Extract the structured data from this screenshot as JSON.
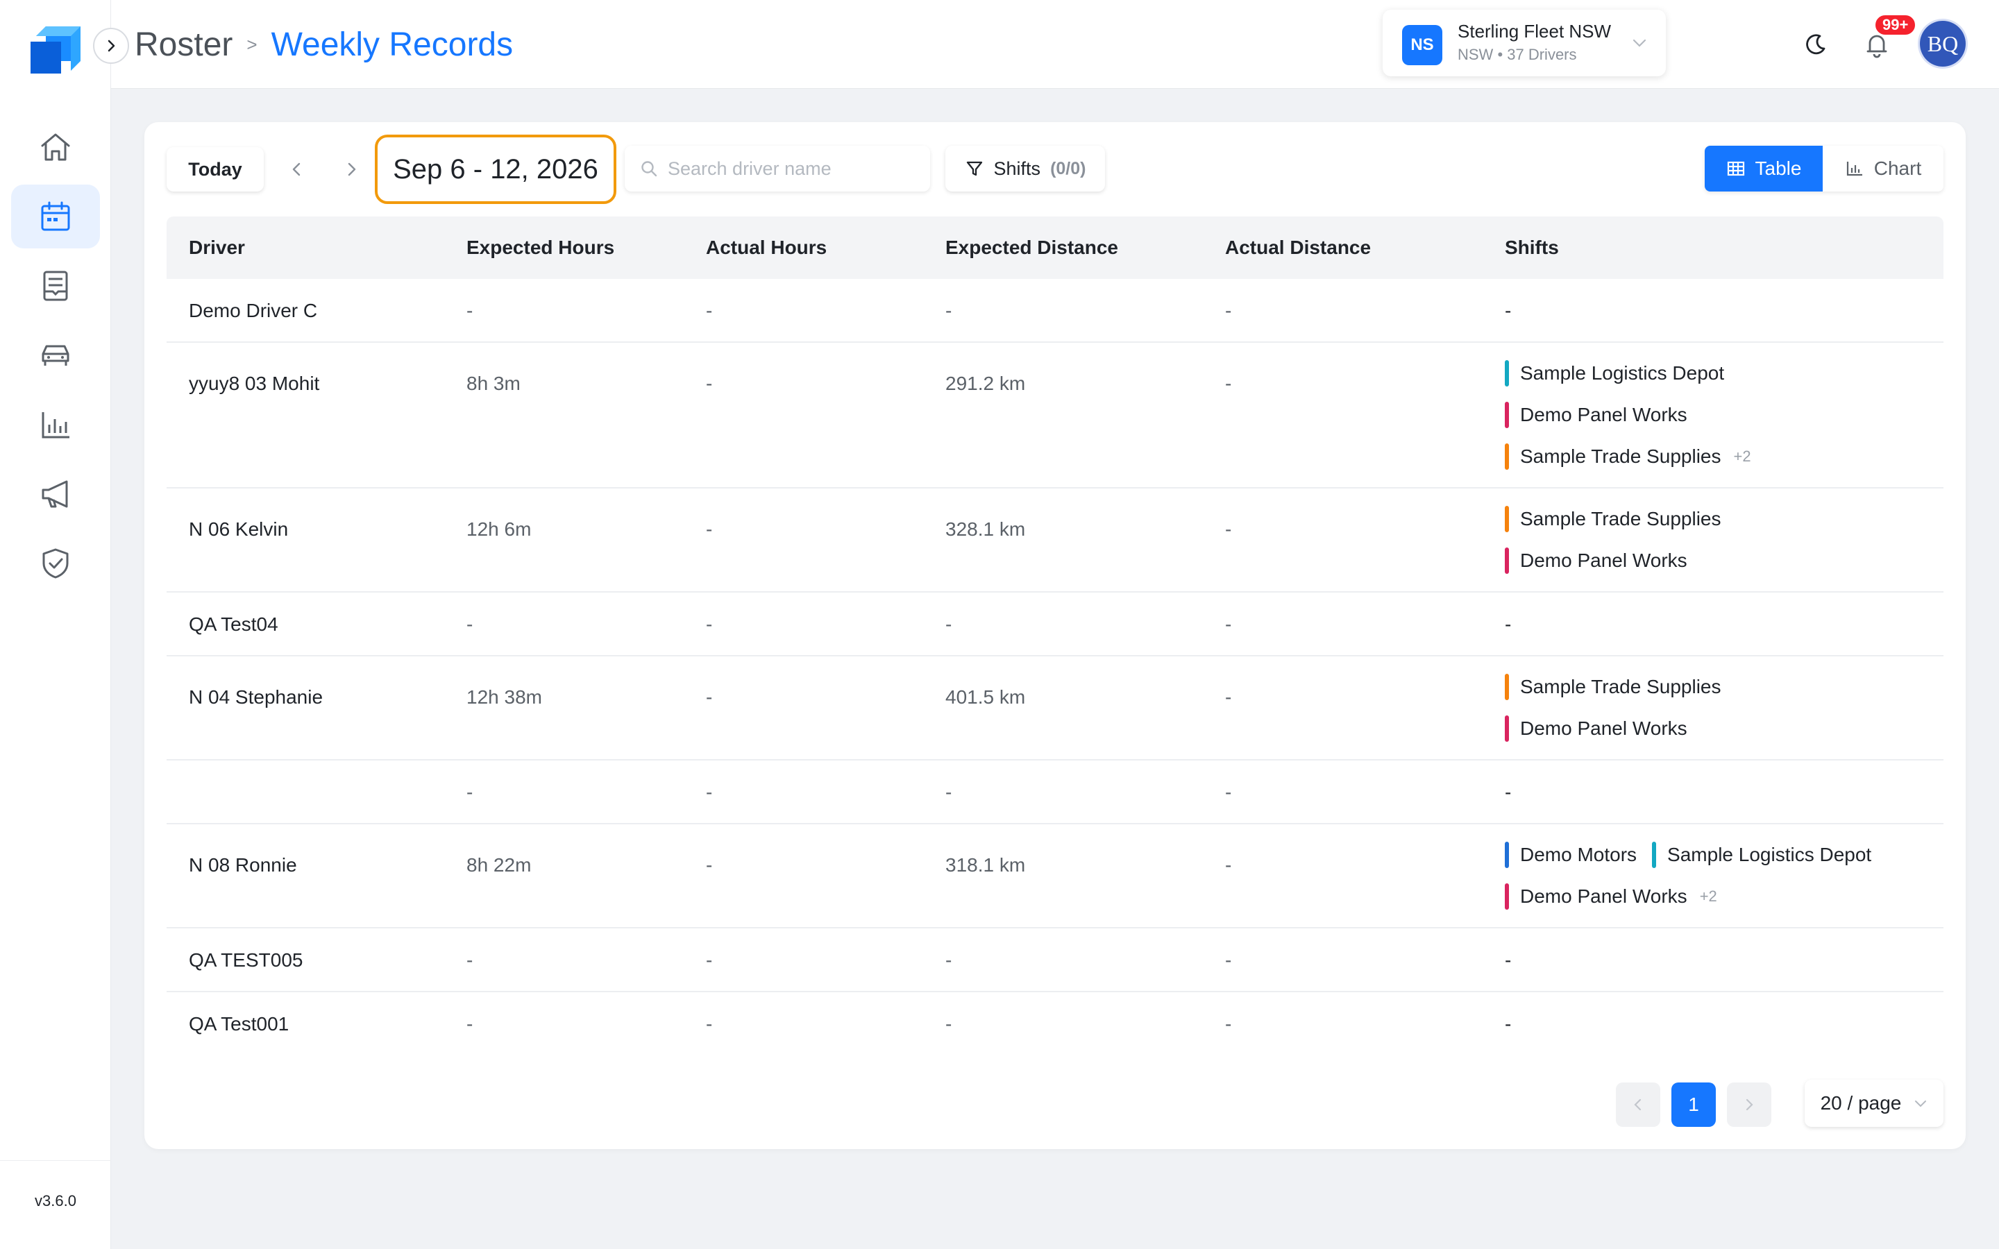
{
  "app": {
    "version": "v3.6.0"
  },
  "breadcrumb": {
    "root": "Roster",
    "separator": ">",
    "current": "Weekly Records"
  },
  "fleet": {
    "initials": "NS",
    "name": "Sterling Fleet NSW",
    "subtitle": "NSW • 37 Drivers"
  },
  "notifications": {
    "badge": "99+"
  },
  "user": {
    "initials": "BQ"
  },
  "sidebar": {
    "items": [
      {
        "name": "home-icon",
        "active": false
      },
      {
        "name": "calendar-icon",
        "active": true
      },
      {
        "name": "document-icon",
        "active": false
      },
      {
        "name": "car-icon",
        "active": false
      },
      {
        "name": "bar-chart-icon",
        "active": false
      },
      {
        "name": "megaphone-icon",
        "active": false
      },
      {
        "name": "shield-check-icon",
        "active": false
      }
    ]
  },
  "toolbar": {
    "today_label": "Today",
    "date_range": "Sep 6 - 12, 2026",
    "search_placeholder": "Search driver name",
    "search_value": "",
    "shifts_label": "Shifts",
    "shifts_count": "(0/0)",
    "view_table_label": "Table",
    "view_chart_label": "Chart"
  },
  "colors": {
    "accent": "#1677ff",
    "highlight": "#f29a0c",
    "sample_logistics_depot": "#13a8c2",
    "demo_panel_works": "#d9245f",
    "sample_trade_supplies": "#f5820d",
    "demo_motors": "#1f6fd6"
  },
  "table": {
    "columns": [
      "Driver",
      "Expected Hours",
      "Actual Hours",
      "Expected Distance",
      "Actual Distance",
      "Shifts"
    ],
    "rows": [
      {
        "driver": "Demo Driver C",
        "expected_hours": "-",
        "actual_hours": "-",
        "expected_distance": "-",
        "actual_distance": "-",
        "shifts_text": "-",
        "shifts": []
      },
      {
        "driver": "yyuy8 03 Mohit",
        "expected_hours": "8h 3m",
        "actual_hours": "-",
        "expected_distance": "291.2 km",
        "actual_distance": "-",
        "shifts_text": "",
        "shifts": [
          [
            {
              "label": "Sample Logistics Depot",
              "color": "#13a8c2"
            }
          ],
          [
            {
              "label": "Demo Panel Works",
              "color": "#d9245f"
            }
          ],
          [
            {
              "label": "Sample Trade Supplies",
              "color": "#f5820d"
            }
          ]
        ],
        "more": "+2"
      },
      {
        "driver": "N 06 Kelvin",
        "expected_hours": "12h 6m",
        "actual_hours": "-",
        "expected_distance": "328.1 km",
        "actual_distance": "-",
        "shifts_text": "",
        "shifts": [
          [
            {
              "label": "Sample Trade Supplies",
              "color": "#f5820d"
            }
          ],
          [
            {
              "label": "Demo Panel Works",
              "color": "#d9245f"
            }
          ]
        ]
      },
      {
        "driver": "QA Test04",
        "expected_hours": "-",
        "actual_hours": "-",
        "expected_distance": "-",
        "actual_distance": "-",
        "shifts_text": "-",
        "shifts": []
      },
      {
        "driver": "N 04 Stephanie",
        "expected_hours": "12h 38m",
        "actual_hours": "-",
        "expected_distance": "401.5 km",
        "actual_distance": "-",
        "shifts_text": "",
        "shifts": [
          [
            {
              "label": "Sample Trade Supplies",
              "color": "#f5820d"
            }
          ],
          [
            {
              "label": "Demo Panel Works",
              "color": "#d9245f"
            }
          ]
        ]
      },
      {
        "driver": "",
        "expected_hours": "-",
        "actual_hours": "-",
        "expected_distance": "-",
        "actual_distance": "-",
        "shifts_text": "-",
        "shifts": []
      },
      {
        "driver": "N 08 Ronnie",
        "expected_hours": "8h 22m",
        "actual_hours": "-",
        "expected_distance": "318.1 km",
        "actual_distance": "-",
        "shifts_text": "",
        "shifts": [
          [
            {
              "label": "Demo Motors",
              "color": "#1f6fd6"
            },
            {
              "label": "Sample Logistics Depot",
              "color": "#13a8c2"
            }
          ],
          [
            {
              "label": "Demo Panel Works",
              "color": "#d9245f"
            }
          ]
        ],
        "more": "+2"
      },
      {
        "driver": "QA TEST005",
        "expected_hours": "-",
        "actual_hours": "-",
        "expected_distance": "-",
        "actual_distance": "-",
        "shifts_text": "-",
        "shifts": []
      },
      {
        "driver": "QA Test001",
        "expected_hours": "-",
        "actual_hours": "-",
        "expected_distance": "-",
        "actual_distance": "-",
        "shifts_text": "-",
        "shifts": []
      }
    ]
  },
  "pagination": {
    "current_page": "1",
    "page_size_label": "20 / page"
  }
}
